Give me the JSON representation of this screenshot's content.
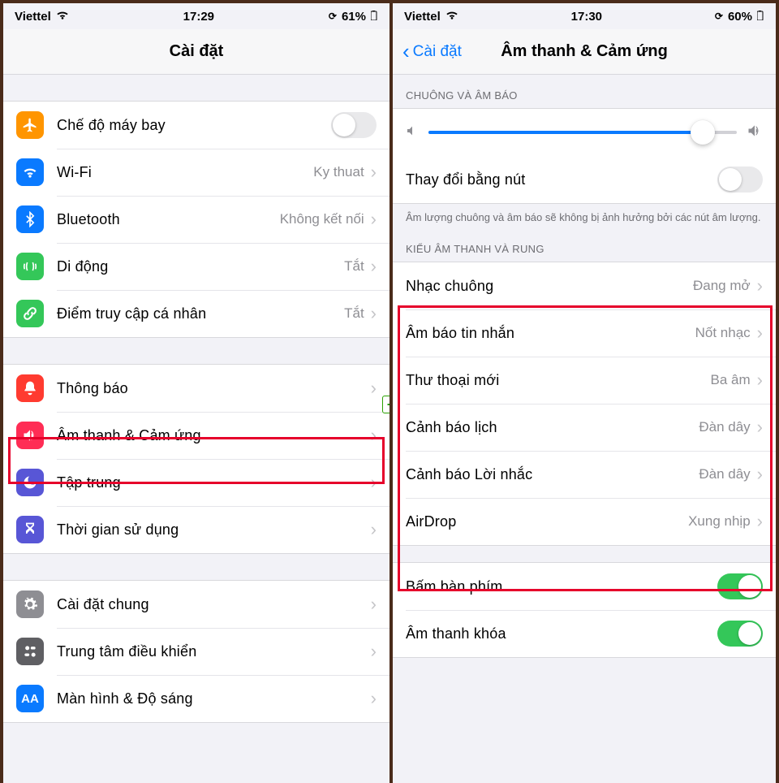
{
  "left": {
    "status": {
      "carrier": "Viettel",
      "time": "17:29",
      "battery": "61%"
    },
    "nav": {
      "title": "Cài đặt"
    },
    "group1": [
      {
        "icon": "airplane",
        "color": "bg-orange",
        "label": "Chế độ máy bay",
        "toggle": false
      },
      {
        "icon": "wifi",
        "color": "bg-blue",
        "label": "Wi-Fi",
        "value": "Ky thuat"
      },
      {
        "icon": "bluetooth",
        "color": "bg-blue",
        "label": "Bluetooth",
        "value": "Không kết nối"
      },
      {
        "icon": "cellular",
        "color": "bg-green",
        "label": "Di động",
        "value": "Tắt"
      },
      {
        "icon": "hotspot",
        "color": "bg-link",
        "label": "Điểm truy cập cá nhân",
        "value": "Tắt"
      }
    ],
    "group2": [
      {
        "icon": "bell",
        "color": "bg-red",
        "label": "Thông báo"
      },
      {
        "icon": "sound",
        "color": "bg-pink",
        "label": "Âm thanh & Cảm ứng"
      },
      {
        "icon": "moon",
        "color": "bg-indigo",
        "label": "Tập trung"
      },
      {
        "icon": "timer",
        "color": "bg-indigo",
        "label": "Thời gian sử dụng"
      }
    ],
    "group3": [
      {
        "icon": "gear",
        "color": "bg-gray",
        "label": "Cài đặt chung"
      },
      {
        "icon": "control",
        "color": "bg-dark",
        "label": "Trung tâm điều khiển"
      },
      {
        "icon": "aa",
        "color": "bg-blue",
        "label": "Màn hình & Độ sáng"
      }
    ]
  },
  "right": {
    "status": {
      "carrier": "Viettel",
      "time": "17:30",
      "battery": "60%"
    },
    "nav": {
      "back": "Cài đặt",
      "title": "Âm thanh & Cảm ứng"
    },
    "section1": {
      "header": "CHUÔNG VÀ ÂM BÁO",
      "slider_pct": 89,
      "change_label": "Thay đổi bằng nút",
      "change_toggle": false,
      "footer": "Âm lượng chuông và âm báo sẽ không bị ảnh hưởng bởi các nút âm lượng."
    },
    "section2": {
      "header": "KIỂU ÂM THANH VÀ RUNG",
      "rows": [
        {
          "label": "Nhạc chuông",
          "value": "Đang mở"
        },
        {
          "label": "Âm báo tin nhắn",
          "value": "Nốt nhạc"
        },
        {
          "label": "Thư thoại mới",
          "value": "Ba âm"
        },
        {
          "label": "Cảnh báo lịch",
          "value": "Đàn dây"
        },
        {
          "label": "Cảnh báo Lời nhắc",
          "value": "Đàn dây"
        },
        {
          "label": "AirDrop",
          "value": "Xung nhịp"
        }
      ]
    },
    "section3": {
      "rows": [
        {
          "label": "Bấm bàn phím",
          "toggle": true
        },
        {
          "label": "Âm thanh khóa",
          "toggle": true
        }
      ]
    }
  }
}
